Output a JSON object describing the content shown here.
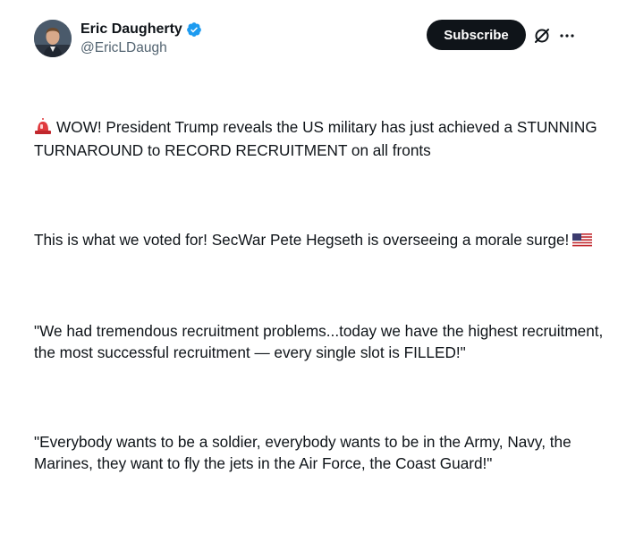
{
  "author": {
    "display_name": "Eric Daugherty",
    "handle": "@EricLDaugh",
    "verified": true
  },
  "actions": {
    "subscribe_label": "Subscribe",
    "grok_icon": "grok-icon",
    "more_icon": "more-icon"
  },
  "tweet": {
    "p1_emoji": "siren-emoji",
    "p1_text": "WOW! President Trump reveals the US military has just achieved a STUNNING TURNAROUND to RECORD RECRUITMENT on all fronts",
    "p2_text": "This is what we voted for! SecWar Pete Hegseth is overseeing a morale surge!",
    "p2_emoji": "us-flag-emoji",
    "p3_text": "\"We had tremendous recruitment problems...today we have the highest recruitment, the most successful recruitment — every single slot is FILLED!\"",
    "p4_text": "\"Everybody wants to be a soldier, everybody wants to be in the Army, Navy, the Marines, they want to fly the jets in the Air Force, the Coast Guard!\""
  },
  "colors": {
    "text": "#0f1419",
    "secondary": "#536471",
    "verified": "#1d9bf0",
    "button_bg": "#0f1419"
  }
}
